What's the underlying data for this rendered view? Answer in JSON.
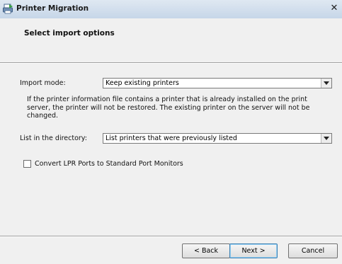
{
  "window": {
    "title": "Printer Migration",
    "close_glyph": "✕",
    "icon": "printer-migration-icon"
  },
  "header": {
    "heading": "Select import options"
  },
  "import_mode": {
    "label": "Import mode:",
    "selected": "Keep existing printers"
  },
  "info_text": "If the printer information file contains a printer that is already installed on the print server, the printer will not be restored. The existing printer on the server will not be changed.",
  "directory": {
    "label": "List in the directory:",
    "selected": "List printers that were previously listed"
  },
  "convert_lpr": {
    "label": "Convert LPR Ports to Standard Port Monitors",
    "checked": false
  },
  "buttons": {
    "back": "< Back",
    "next": "Next >",
    "cancel": "Cancel"
  }
}
